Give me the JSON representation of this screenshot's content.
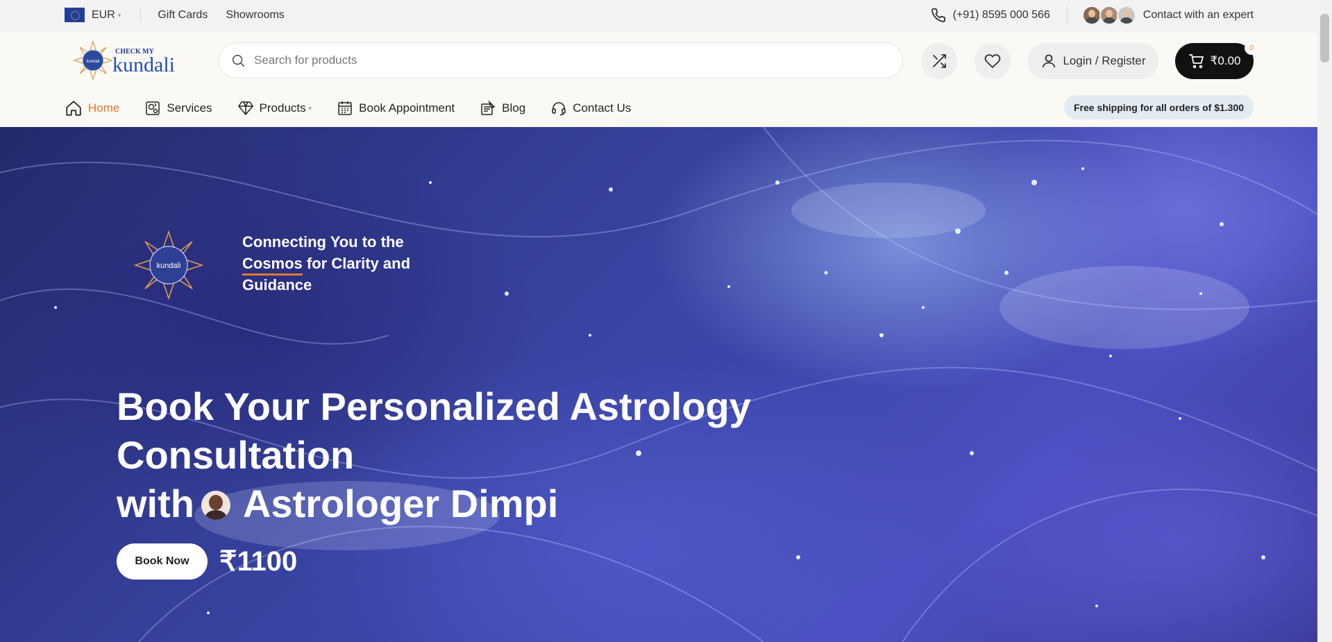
{
  "topbar": {
    "currency": "EUR",
    "links": [
      "Gift Cards",
      "Showrooms"
    ],
    "phone": "(+91) 8595 000 566",
    "expert_label": "Contact with an expert"
  },
  "header": {
    "logo_text_top": "CHECK MY",
    "logo_text_main": "kundali",
    "search_placeholder": "Search for products",
    "login_label": "Login / Register",
    "cart_total": "₹0.00",
    "cart_count": "0"
  },
  "nav": {
    "items": [
      {
        "label": "Home",
        "icon": "home-icon"
      },
      {
        "label": "Services",
        "icon": "services-icon"
      },
      {
        "label": "Products",
        "icon": "diamond-icon"
      },
      {
        "label": "Book Appointment",
        "icon": "calendar-icon"
      },
      {
        "label": "Blog",
        "icon": "blog-icon"
      },
      {
        "label": "Contact Us",
        "icon": "headset-icon"
      }
    ],
    "shipping_badge": "Free shipping for all orders of $1.300"
  },
  "hero": {
    "tagline_part1": "Connecting You to the ",
    "tagline_underlined": "Cosmos",
    "tagline_part2": " for Clarity and Guidance",
    "headline_line1": "Book Your Personalized Astrology Consultation",
    "headline_with": "with",
    "headline_name": "Astrologer Dimpi",
    "cta_label": "Book Now",
    "price": "₹1100"
  },
  "colors": {
    "accent": "#e3782f",
    "cart_bg": "#111111",
    "badge_bg": "#e2ebf2",
    "hero_base": "#35409a"
  }
}
